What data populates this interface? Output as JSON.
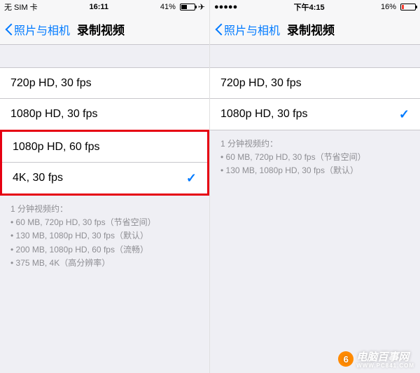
{
  "left": {
    "status": {
      "carrier": "无 SIM 卡",
      "time": "16:11",
      "battery_pct": "41%",
      "battery_fill_pct": 41,
      "airplane": "✈"
    },
    "nav": {
      "back_label": "照片与相机",
      "title": "录制视频"
    },
    "options": [
      {
        "label": "720p HD, 30 fps",
        "selected": false
      },
      {
        "label": "1080p HD, 30 fps",
        "selected": false
      },
      {
        "label": "1080p HD, 60 fps",
        "selected": false,
        "highlight": true
      },
      {
        "label": "4K, 30 fps",
        "selected": true,
        "highlight": true
      }
    ],
    "footer": {
      "title": "1 分钟视频约：",
      "lines": [
        "• 60 MB, 720p HD, 30 fps（节省空间）",
        "• 130 MB, 1080p HD, 30 fps（默认）",
        "• 200 MB, 1080p HD, 60 fps（流畅）",
        "• 375 MB, 4K（高分辨率）"
      ]
    }
  },
  "right": {
    "status": {
      "time": "下午4:15",
      "battery_pct": "16%",
      "battery_fill_pct": 16
    },
    "nav": {
      "back_label": "照片与相机",
      "title": "录制视频"
    },
    "options": [
      {
        "label": "720p HD, 30 fps",
        "selected": false
      },
      {
        "label": "1080p HD, 30 fps",
        "selected": true
      }
    ],
    "footer": {
      "title": "1 分钟视频约：",
      "lines": [
        "• 60 MB, 720p HD, 30 fps（节省空间）",
        "• 130 MB, 1080p HD, 30 fps（默认）"
      ]
    }
  },
  "watermark": {
    "logo_char": "6",
    "text": "电脑百事网",
    "sub": "WWW.PC841.COM"
  }
}
